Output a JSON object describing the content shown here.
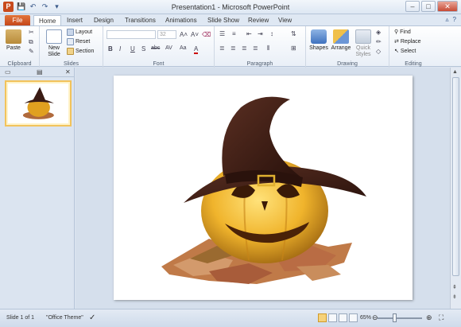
{
  "window": {
    "title": "Presentation1 - Microsoft PowerPoint",
    "app_letter": "P"
  },
  "qat": {
    "save": "💾",
    "undo": "↶",
    "redo": "↷",
    "customize": "▾"
  },
  "tabs": [
    "File",
    "Home",
    "Insert",
    "Design",
    "Transitions",
    "Animations",
    "Slide Show",
    "Review",
    "View"
  ],
  "ribbon": {
    "clipboard": {
      "paste": "Paste",
      "label": "Clipboard"
    },
    "slides": {
      "new_slide": "New Slide",
      "layout": "Layout",
      "reset": "Reset",
      "section": "Section",
      "label": "Slides"
    },
    "font": {
      "size": "32",
      "label": "Font",
      "buttons": [
        "B",
        "I",
        "U",
        "S",
        "abc",
        "AV",
        "Aa",
        "A"
      ]
    },
    "paragraph": {
      "label": "Paragraph"
    },
    "drawing": {
      "shapes": "Shapes",
      "arrange": "Arrange",
      "quick_styles": "Quick Styles",
      "label": "Drawing"
    },
    "editing": {
      "find": "Find",
      "replace": "Replace",
      "select": "Select",
      "label": "Editing"
    }
  },
  "slides_panel": {
    "thumbnail_number": "1"
  },
  "status": {
    "slide": "Slide 1 of 1",
    "theme": "\"Office Theme\"",
    "zoom": "65%"
  },
  "colors": {
    "file_tab": "#c5471a",
    "pumpkin": "#e0a020",
    "hat": "#3a1b14",
    "leaves": "#b06a3c"
  }
}
